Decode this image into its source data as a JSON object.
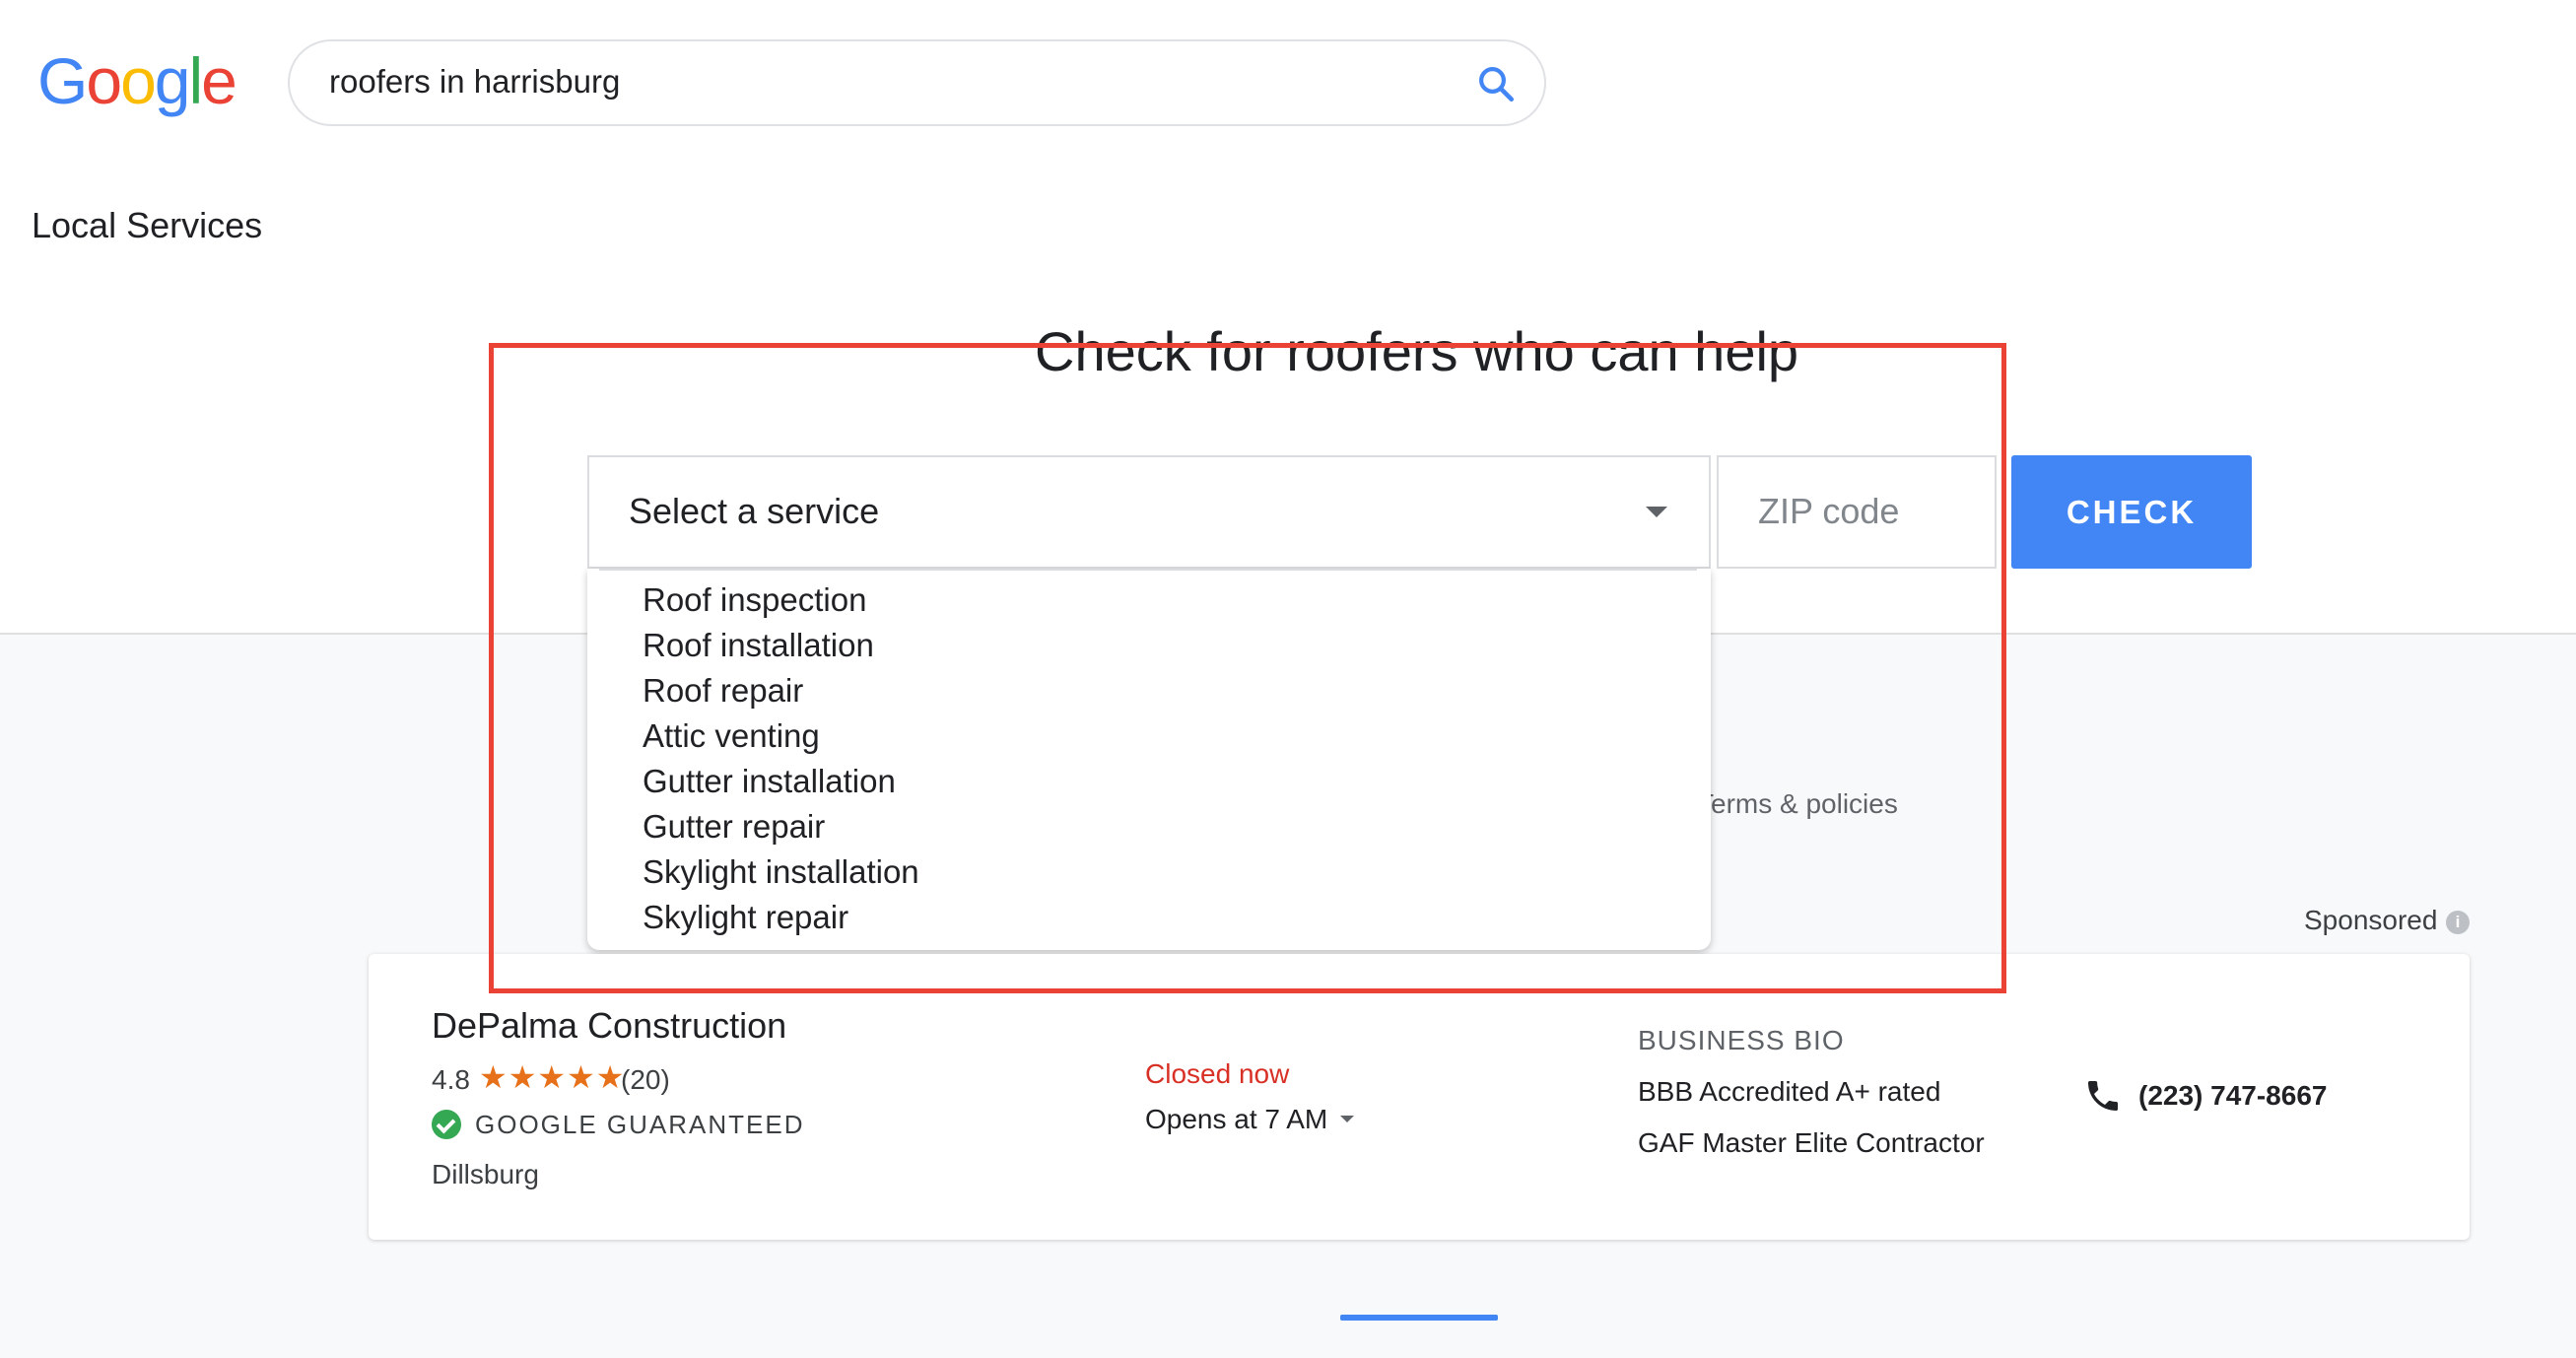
{
  "logo": {
    "letters": [
      "G",
      "o",
      "o",
      "g",
      "l",
      "e"
    ],
    "colors": [
      "#4285f4",
      "#ea4335",
      "#fbbc05",
      "#4285f4",
      "#34a853",
      "#ea4335"
    ]
  },
  "search": {
    "query": "roofers in harrisburg",
    "icon": "search-icon"
  },
  "section_title": "Local Services",
  "main_heading": "Check for roofers who can help",
  "service_select": {
    "label": "Select a service",
    "options": [
      "Roof inspection",
      "Roof installation",
      "Roof repair",
      "Attic venting",
      "Gutter installation",
      "Gutter repair",
      "Skylight installation",
      "Skylight repair"
    ]
  },
  "zip": {
    "placeholder": "ZIP code"
  },
  "check_button": {
    "label": "CHECK"
  },
  "terms_link": "Terms & policies",
  "sponsored": {
    "label": "Sponsored",
    "info_icon": "i"
  },
  "listing": {
    "name": "DePalma Construction",
    "rating": "4.8",
    "stars": "★★★★★",
    "reviews": "(20)",
    "guarantee": "GOOGLE GUARANTEED",
    "location": "Dillsburg",
    "status": "Closed now",
    "opens": "Opens at 7 AM",
    "bio_heading": "BUSINESS BIO",
    "bio": [
      "BBB Accredited A+ rated",
      "GAF Master Elite Contractor"
    ],
    "phone": "(223) 747-8667"
  },
  "colors": {
    "accent": "#4285f4",
    "closed": "#d93025",
    "stars": "#e7711b",
    "guaranteed": "#34a853",
    "annotation": "#ea4335"
  }
}
